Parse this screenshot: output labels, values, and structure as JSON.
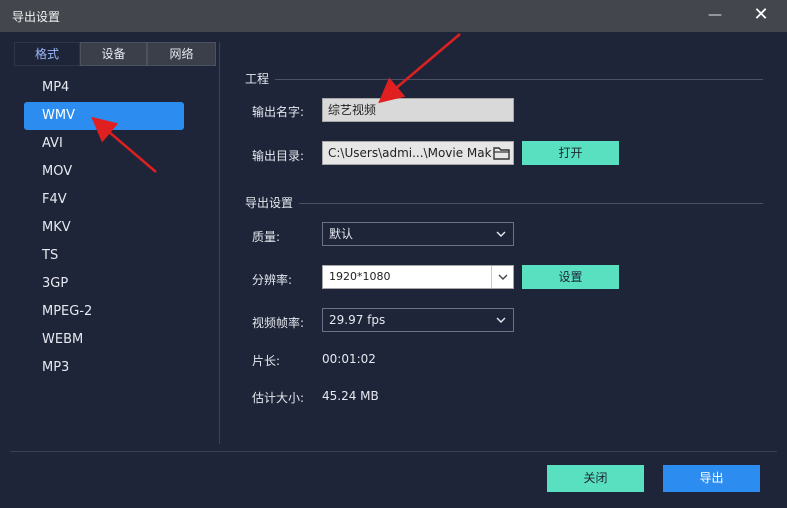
{
  "window": {
    "title": "导出设置",
    "minimize_glyph": "—",
    "close_glyph": "✕"
  },
  "tabs": [
    {
      "label": "格式",
      "active": true
    },
    {
      "label": "设备",
      "active": false
    },
    {
      "label": "网络",
      "active": false
    }
  ],
  "formats": [
    "MP4",
    "WMV",
    "AVI",
    "MOV",
    "F4V",
    "MKV",
    "TS",
    "3GP",
    "MPEG-2",
    "WEBM",
    "MP3"
  ],
  "selected_format": "WMV",
  "project": {
    "group_label": "工程",
    "name_label": "输出名字:",
    "name_value": "综艺视频",
    "dir_label": "输出目录:",
    "dir_value": "C:\\Users\\admi...\\Movie Mak",
    "open_button": "打开"
  },
  "export": {
    "group_label": "导出设置",
    "quality_label": "质量:",
    "quality_value": "默认",
    "resolution_label": "分辨率:",
    "resolution_value": "1920*1080",
    "settings_button": "设置",
    "framerate_label": "视频帧率:",
    "framerate_value": "29.97 fps",
    "duration_label": "片长:",
    "duration_value": "00:01:02",
    "size_label": "估计大小:",
    "size_value": "45.24 MB"
  },
  "footer": {
    "close_button": "关闭",
    "export_button": "导出"
  },
  "colors": {
    "accent_blue": "#2d8cf0",
    "accent_green": "#58e0c0",
    "annotation_red": "#e02020"
  }
}
